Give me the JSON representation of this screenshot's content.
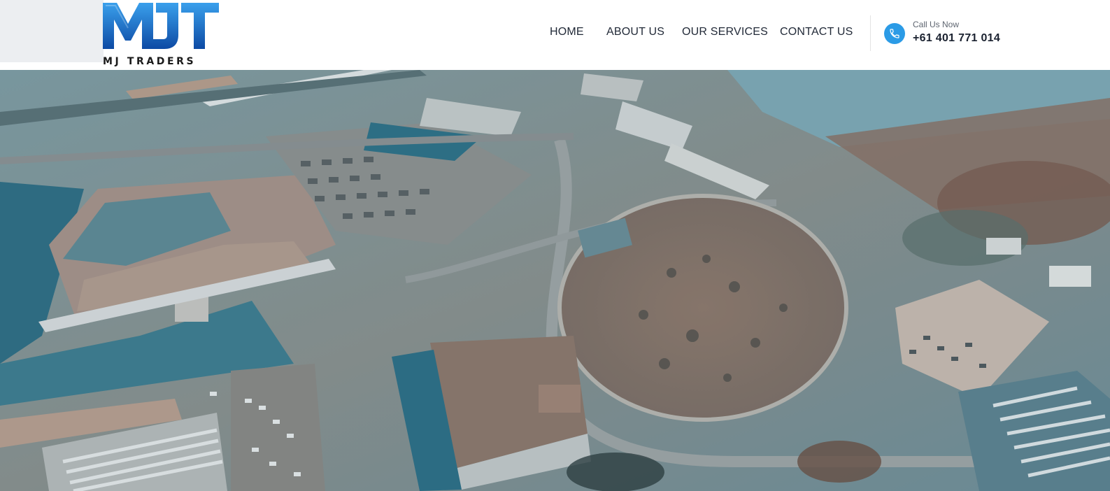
{
  "brand": {
    "logo_letters": "MJT",
    "name": "MJ TRADERS",
    "colors": {
      "logo_gradient_top": "#2f8fe0",
      "logo_gradient_bottom": "#0f4fa8",
      "accent": "#2b9be6"
    }
  },
  "nav": {
    "items": [
      {
        "label": "HOME"
      },
      {
        "label": "ABOUT US"
      },
      {
        "label": "OUR SERVICES"
      },
      {
        "label": "CONTACT US"
      }
    ]
  },
  "contact": {
    "icon": "phone-icon",
    "label": "Call Us Now",
    "phone": "+61 401 771 014"
  },
  "hero": {
    "image": "aerial-industrial-area-photo"
  }
}
